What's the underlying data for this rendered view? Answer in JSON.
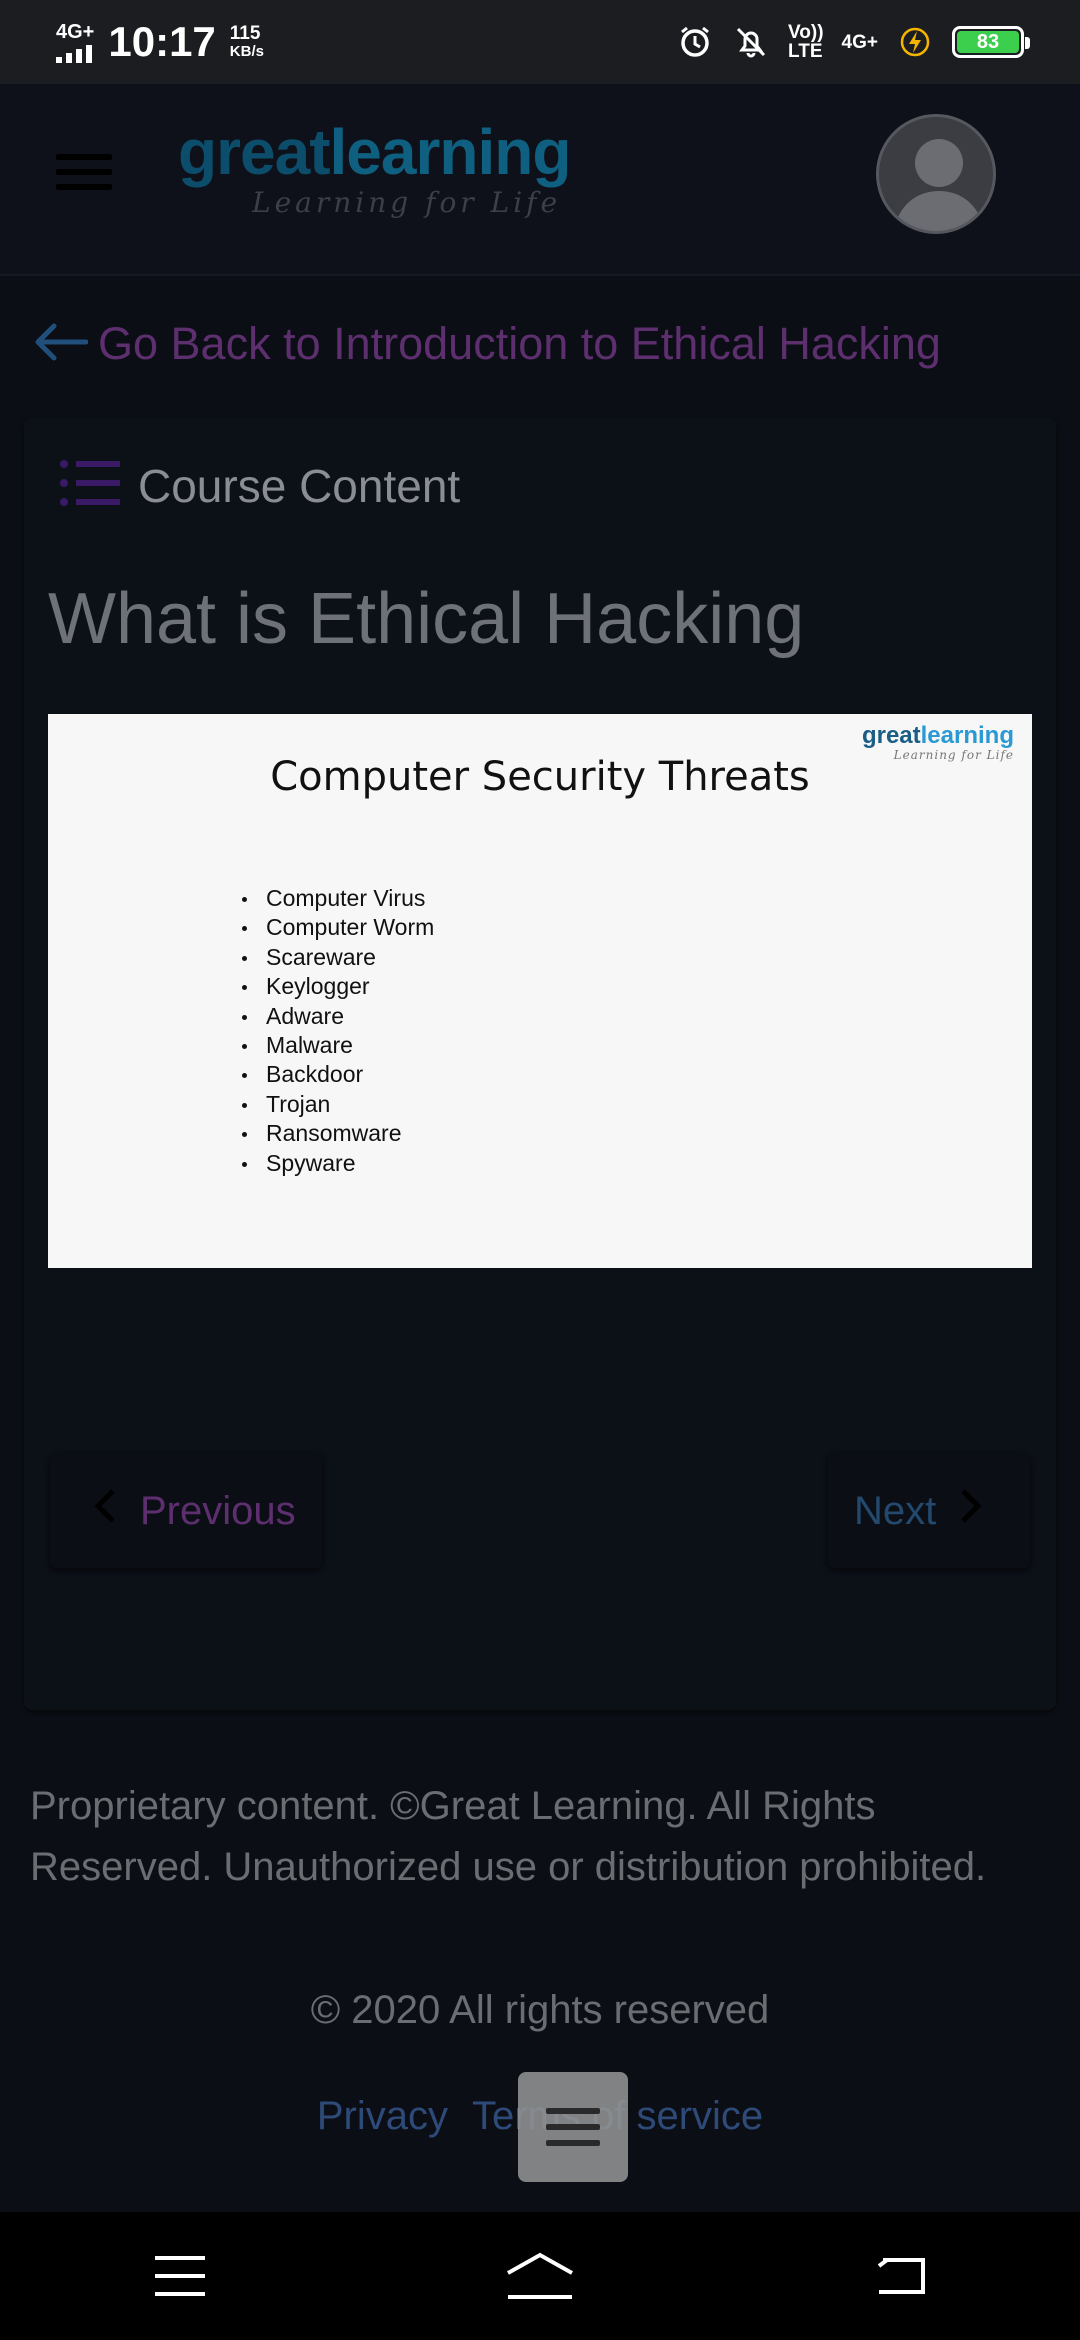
{
  "status_bar": {
    "network": "4G+",
    "time": "10:17",
    "speed_value": "115",
    "speed_unit": "KB/s",
    "volte": "Vo)) LTE",
    "volte_top": "Vo))",
    "volte_bottom": "LTE",
    "network2": "4G+",
    "battery": "83",
    "icons": [
      "alarm-icon",
      "notifications-off-icon",
      "charging-icon"
    ]
  },
  "header": {
    "logo_great": "great",
    "logo_learning": "learning",
    "logo_tagline": "Learning for Life"
  },
  "back_link": {
    "label": "Go Back to Introduction to Ethical Hacking",
    "color": "#5d2f6f"
  },
  "course_content": {
    "label": "Course Content"
  },
  "lesson": {
    "title": "What is Ethical Hacking"
  },
  "slide": {
    "logo_great": "great",
    "logo_learning": "learning",
    "logo_tagline": "Learning for Life",
    "title": "Computer Security Threats",
    "items": [
      "Computer Virus",
      "Computer Worm",
      "Scareware",
      "Keylogger",
      "Adware",
      "Malware",
      "Backdoor",
      "Trojan",
      "Ransomware",
      "Spyware"
    ]
  },
  "navigation": {
    "previous_label": "Previous",
    "next_label": "Next"
  },
  "footer": {
    "notice": "Proprietary content. ©Great Learning. All Rights Reserved. Unauthorized use or distribution prohibited.",
    "copyright": "© 2020 All rights reserved",
    "privacy_label": "Privacy",
    "terms_label": "Terms of service"
  },
  "colors": {
    "background": "#0b0e14",
    "accent_purple": "#5d2f6f",
    "link_blue": "#2d4a78",
    "battery_green": "#3ccf4e"
  }
}
